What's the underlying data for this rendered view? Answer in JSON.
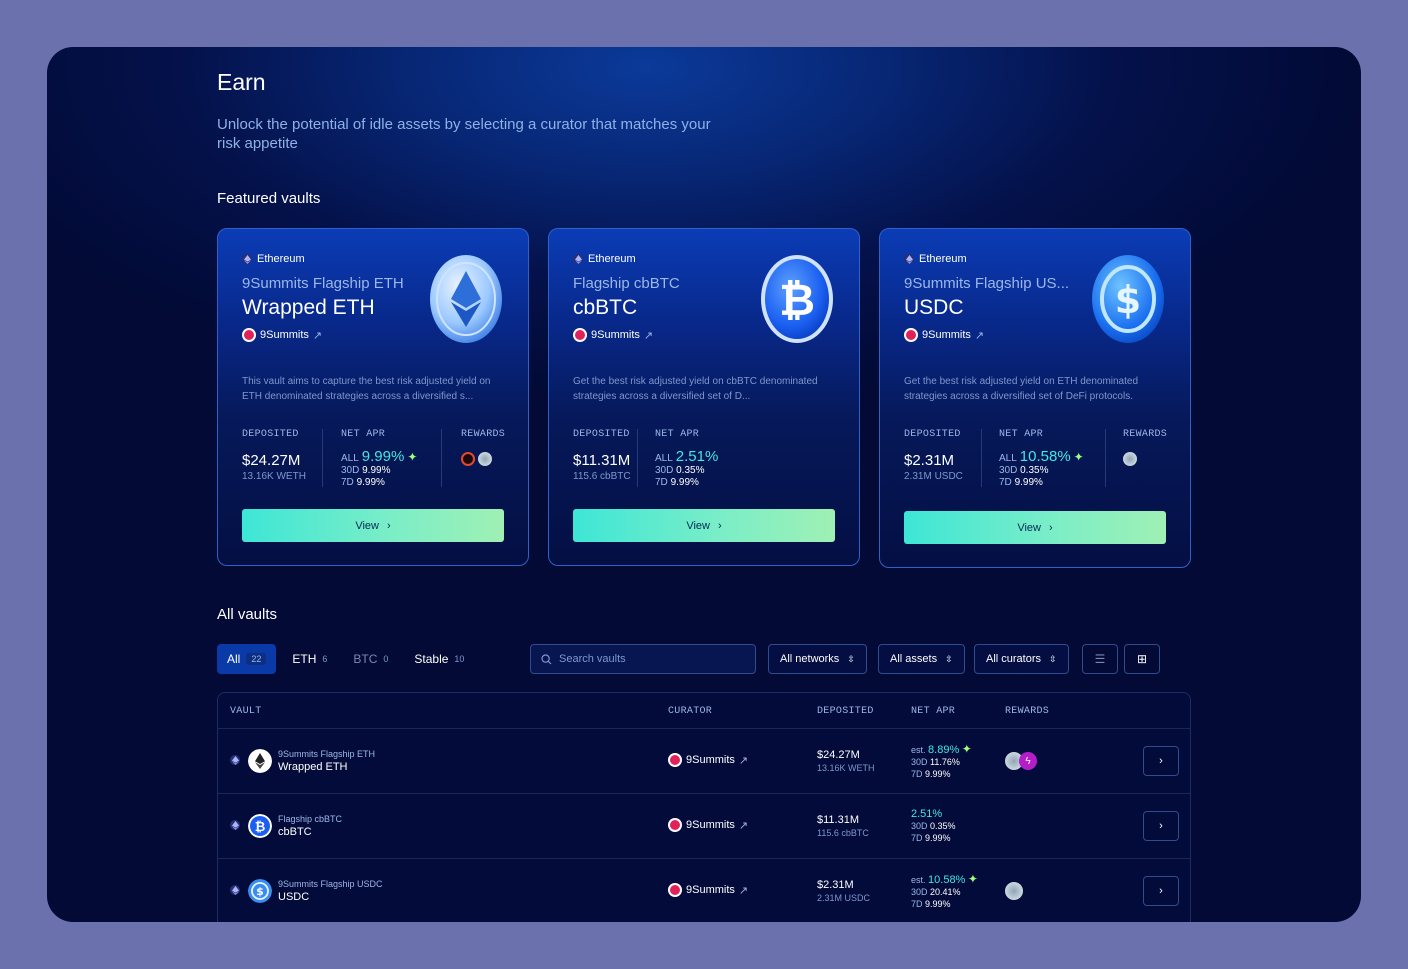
{
  "header": {
    "title": "Earn",
    "subtitle": "Unlock the potential of idle assets by selecting a curator that matches your risk appetite",
    "featured_title": "Featured vaults",
    "all_title": "All vaults"
  },
  "colors": {
    "accent": "#42e6e2",
    "card_border": "#2f61c6",
    "curator": "#e0215a"
  },
  "cards": [
    {
      "network": "Ethereum",
      "name": "9Summits Flagship ETH",
      "asset": "Wrapped ETH",
      "curator": "9Summits",
      "description": "This vault aims to capture the best risk adjusted yield on ETH denominated strategies across a diversified s...",
      "deposited_label": "DEPOSITED",
      "deposited": "$24.27M",
      "deposited_sub": "13.16K WETH",
      "apr_label": "NET APR",
      "apr_all_label": "ALL",
      "apr_all": "9.99%",
      "apr_30d": "9.99%",
      "apr_7d": "9.99%",
      "rewards_label": "REWARDS",
      "view_label": "View",
      "icon": "eth-coin-icon"
    },
    {
      "network": "Ethereum",
      "name": "Flagship cbBTC",
      "asset": "cbBTC",
      "curator": "9Summits",
      "description": "Get the best risk adjusted yield on cbBTC denominated strategies across a diversified set of D...",
      "deposited_label": "DEPOSITED",
      "deposited": "$11.31M",
      "deposited_sub": "115.6 cbBTC",
      "apr_label": "NET APR",
      "apr_all_label": "ALL",
      "apr_all": "2.51%",
      "apr_30d": "0.35%",
      "apr_7d": "9.99%",
      "view_label": "View",
      "icon": "btc-coin-icon"
    },
    {
      "network": "Ethereum",
      "name": "9Summits Flagship US...",
      "asset": "USDC",
      "curator": "9Summits",
      "description": "Get the best risk adjusted yield on ETH denominated strategies across a diversified set of DeFi protocols.",
      "deposited_label": "DEPOSITED",
      "deposited": "$2.31M",
      "deposited_sub": "2.31M USDC",
      "apr_label": "NET APR",
      "apr_all_label": "ALL",
      "apr_all": "10.58%",
      "apr_30d": "0.35%",
      "apr_7d": "9.99%",
      "rewards_label": "REWARDS",
      "view_label": "View",
      "icon": "usdc-coin-icon"
    }
  ],
  "tabs": [
    {
      "label": "All",
      "count": "22"
    },
    {
      "label": "ETH",
      "count": "6"
    },
    {
      "label": "BTC",
      "count": "0"
    },
    {
      "label": "Stable",
      "count": "10"
    }
  ],
  "search": {
    "placeholder": "Search vaults"
  },
  "filters": {
    "networks": "All networks",
    "assets": "All assets",
    "curators": "All curators"
  },
  "table": {
    "headers": {
      "vault": "VAULT",
      "curator": "CURATOR",
      "deposited": "DEPOSITED",
      "apr": "NET APR",
      "rewards": "REWARDS"
    },
    "rows": [
      {
        "name": "9Summits Flagship ETH",
        "asset": "Wrapped ETH",
        "curator": "9Summits",
        "deposited": "$24.27M",
        "deposited_sub": "13.16K WETH",
        "apr_prefix": "est.",
        "apr": "8.89%",
        "apr_30d_label": "30D",
        "apr_30d": "11.76%",
        "apr_7d_label": "7D",
        "apr_7d": "9.99%"
      },
      {
        "name": "Flagship cbBTC",
        "asset": "cbBTC",
        "curator": "9Summits",
        "deposited": "$11.31M",
        "deposited_sub": "115.6 cbBTC",
        "apr_prefix": "",
        "apr": "2.51%",
        "apr_30d_label": "30D",
        "apr_30d": "0.35%",
        "apr_7d_label": "7D",
        "apr_7d": "9.99%"
      },
      {
        "name": "9Summits Flagship USDC",
        "asset": "USDC",
        "curator": "9Summits",
        "deposited": "$2.31M",
        "deposited_sub": "2.31M USDC",
        "apr_prefix": "est.",
        "apr": "10.58%",
        "apr_30d_label": "30D",
        "apr_30d": "20.41%",
        "apr_7d_label": "7D",
        "apr_7d": "9.99%"
      }
    ]
  }
}
